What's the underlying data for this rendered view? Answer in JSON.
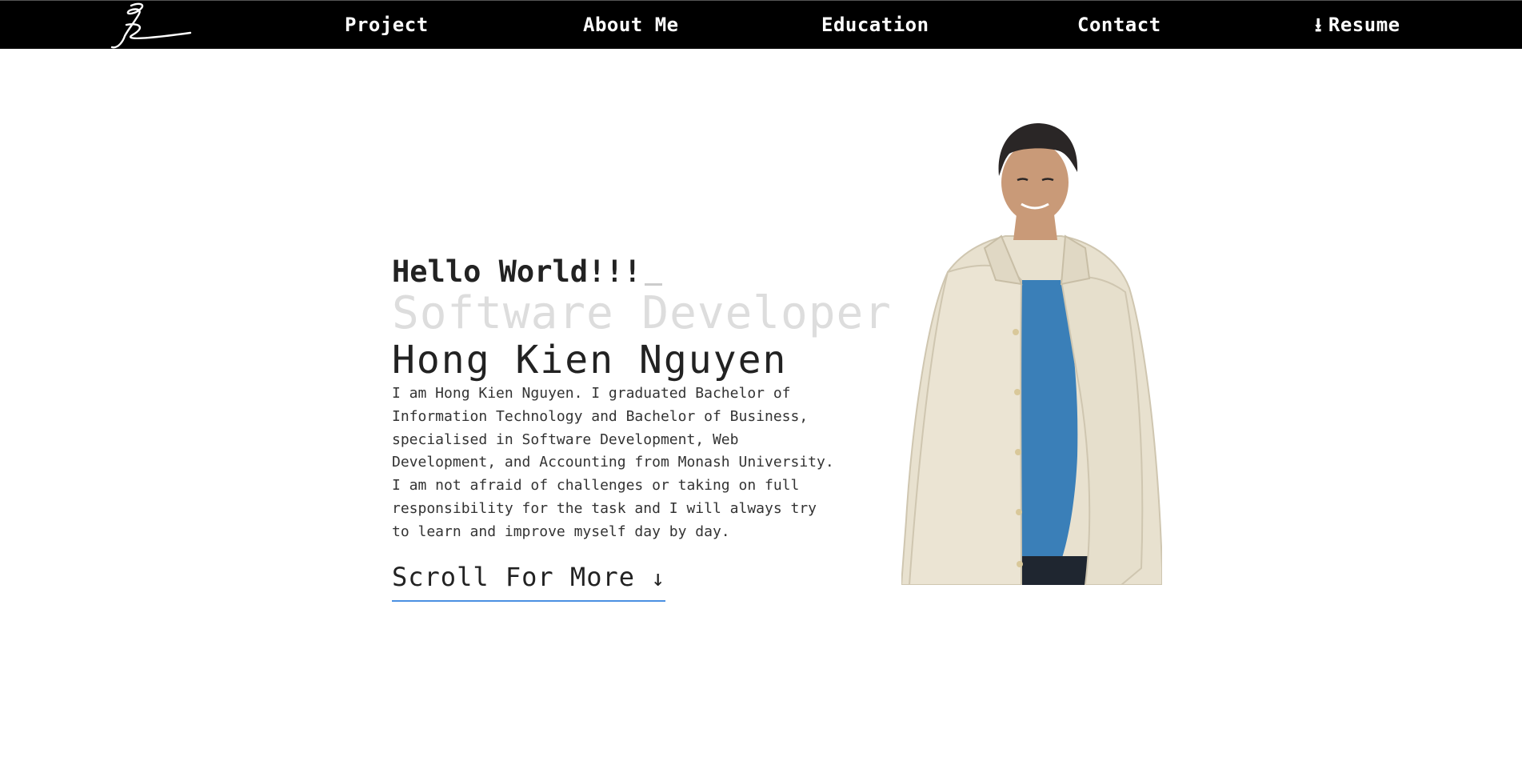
{
  "nav": {
    "items": [
      {
        "label": "Project"
      },
      {
        "label": "About Me"
      },
      {
        "label": "Education"
      },
      {
        "label": "Contact"
      },
      {
        "label": "Resume",
        "icon": "download-arrow-icon",
        "icon_glyph": "⭳"
      }
    ]
  },
  "hero": {
    "greeting": "Hello World!!!",
    "role": "Software Developer",
    "name": "Hong Kien Nguyen",
    "bio_lines": [
      "I am Hong Kien Nguyen. I graduated Bachelor of",
      "Information Technology and Bachelor of Business,",
      "specialised in Software Development, Web",
      "Development, and Accounting from Monash University.",
      "I am not afraid of challenges or taking on full",
      "responsibility for the task and I will always try",
      "to learn and improve myself day by day."
    ],
    "scroll_label": "Scroll For More",
    "scroll_icon_glyph": "↓"
  },
  "colors": {
    "nav_bg": "#000000",
    "nav_text": "#ffffff",
    "text_dark": "#222222",
    "role_faded": "#dddddd",
    "accent_underline": "#4a90e2",
    "jacket": "#e8e1cf",
    "shirt": "#3a7fb8",
    "hair": "#2a2626",
    "skin": "#c99a78"
  }
}
